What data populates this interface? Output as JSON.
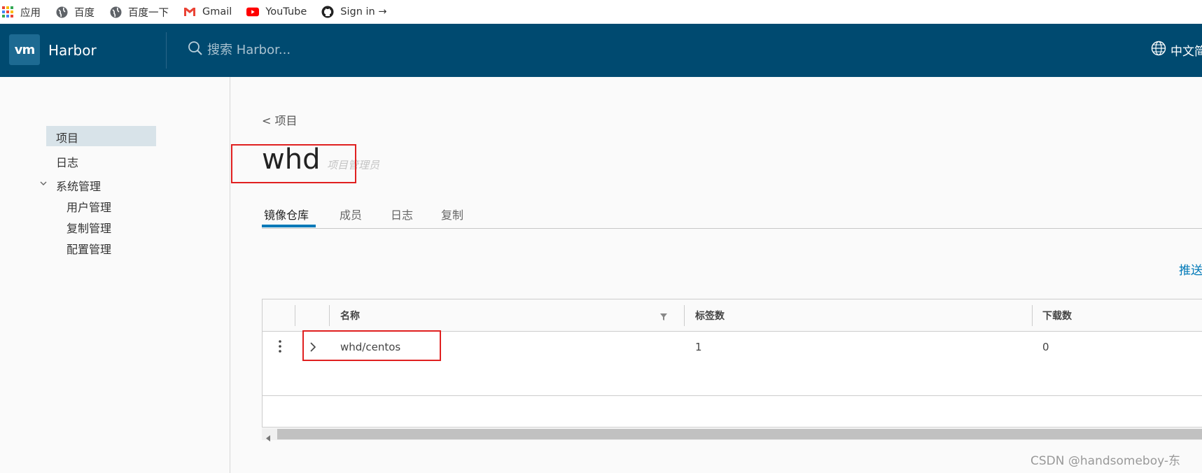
{
  "bookmarks": [
    {
      "label": "应用",
      "icon": "apps-grid-icon"
    },
    {
      "label": "百度",
      "icon": "globe-icon"
    },
    {
      "label": "百度一下",
      "icon": "globe-icon"
    },
    {
      "label": "Gmail",
      "icon": "gmail-icon"
    },
    {
      "label": "YouTube",
      "icon": "youtube-icon"
    },
    {
      "label": "Sign in →",
      "icon": "github-icon"
    }
  ],
  "header": {
    "logo": "vm",
    "app_name": "Harbor",
    "search_placeholder": "搜索 Harbor...",
    "language": "中文简"
  },
  "sidebar": {
    "items": [
      {
        "label": "项目",
        "active": true
      },
      {
        "label": "日志"
      },
      {
        "label": "系统管理",
        "expanded": true
      },
      {
        "label": "用户管理"
      },
      {
        "label": "复制管理"
      },
      {
        "label": "配置管理"
      }
    ]
  },
  "main": {
    "back_link": "< 项目",
    "project_name": "whd",
    "project_role": "项目管理员",
    "tabs": [
      {
        "label": "镜像仓库",
        "active": true
      },
      {
        "label": "成员"
      },
      {
        "label": "日志"
      },
      {
        "label": "复制"
      }
    ],
    "push_link": "推送"
  },
  "table": {
    "columns": [
      "名称",
      "标签数",
      "下载数"
    ],
    "rows": [
      {
        "name": "whd/centos",
        "tags": "1",
        "downloads": "0"
      }
    ]
  },
  "watermark": "CSDN @handsomeboy-东",
  "colors": {
    "header_bg": "#004a70",
    "accent": "#0079b8",
    "annotation_red": "#e02020"
  }
}
